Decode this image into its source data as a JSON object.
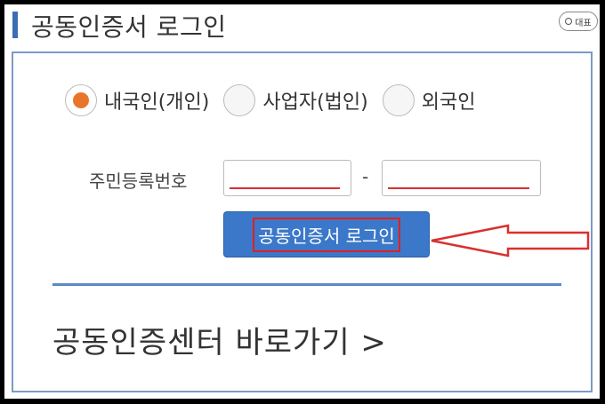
{
  "header": {
    "title": "공동인증서 로그인",
    "badge_label": "대표"
  },
  "user_type": {
    "options": [
      {
        "label": "내국인(개인)",
        "selected": true
      },
      {
        "label": "사업자(법인)",
        "selected": false
      },
      {
        "label": "외국인",
        "selected": false
      }
    ]
  },
  "id_field": {
    "label": "주민등록번호",
    "separator": "-",
    "front_value": "",
    "back_value": ""
  },
  "login_button": {
    "label": "공동인증서 로그인"
  },
  "center_link": {
    "label": "공동인증센터 바로가기 >"
  },
  "colors": {
    "accent_blue": "#3c78c9",
    "radio_selected": "#e8762a",
    "annotation_red": "#d93030"
  }
}
